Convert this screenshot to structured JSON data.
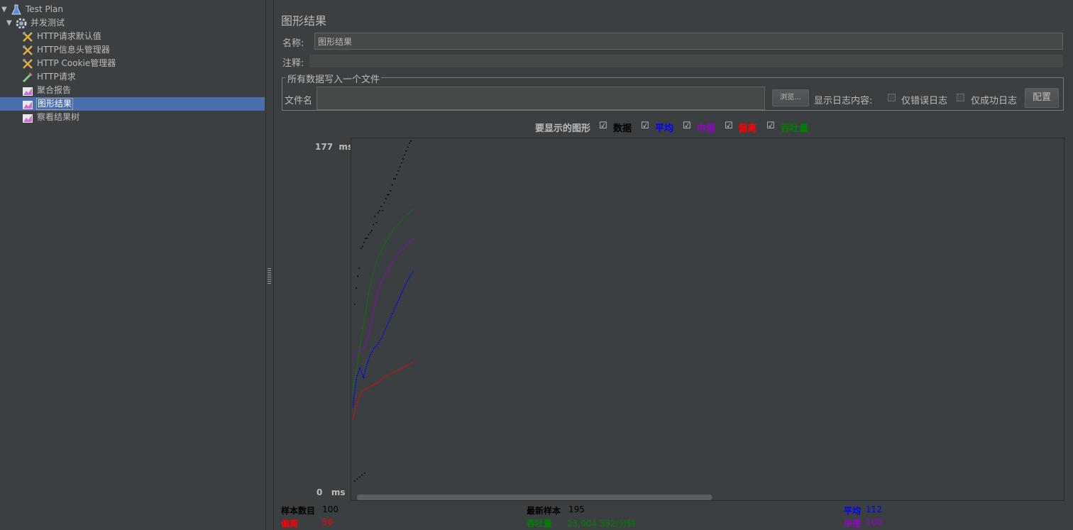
{
  "tree": {
    "items": [
      {
        "label": "Test Plan",
        "icon": "flask-icon",
        "expander": "▼"
      },
      {
        "label": "并发测试",
        "icon": "gear-icon",
        "expander": "▼"
      },
      {
        "label": "HTTP请求默认值",
        "icon": "wrench-icon"
      },
      {
        "label": "HTTP信息头管理器",
        "icon": "wrench-icon"
      },
      {
        "label": "HTTP Cookie管理器",
        "icon": "wrench-icon"
      },
      {
        "label": "HTTP请求",
        "icon": "pipette-icon"
      },
      {
        "label": "聚合报告",
        "icon": "chart-icon"
      },
      {
        "label": "图形结果",
        "icon": "chart-icon",
        "selected": true
      },
      {
        "label": "察看结果树",
        "icon": "chart-icon"
      }
    ]
  },
  "panel": {
    "title": "图形结果",
    "name_label": "名称:",
    "name_value": "图形结果",
    "comment_label": "注释:",
    "comment_value": "",
    "fieldset_legend": "所有数据写入一个文件",
    "filename_label": "文件名",
    "filename_value": "",
    "browse_label": "浏览...",
    "log_content_label": "显示日志内容:",
    "errors_only_label": "仅错误日志",
    "success_only_label": "仅成功日志",
    "configure_label": "配置"
  },
  "graph_options": {
    "label": "要显示的图形",
    "items": [
      {
        "label": "数据",
        "color": "#000000",
        "checked": true
      },
      {
        "label": "平均",
        "color": "#0000ff",
        "checked": true
      },
      {
        "label": "中值",
        "color": "#9900cc",
        "checked": true
      },
      {
        "label": "偏离",
        "color": "#ff0000",
        "checked": true
      },
      {
        "label": "吞吐量",
        "color": "#008000",
        "checked": true
      }
    ]
  },
  "chart_data": {
    "type": "line",
    "y_max_label": "177",
    "y_min_label": "0",
    "y_unit": "ms",
    "ylim": [
      0,
      177
    ],
    "x": "sample index 1–100",
    "series": [
      {
        "name": "数据",
        "color": "#000000",
        "style": "dots",
        "values": [
          95,
          103,
          109,
          113,
          123,
          124,
          126,
          128,
          128,
          130,
          131,
          132,
          135,
          139,
          136,
          141,
          142,
          144,
          142,
          146,
          148,
          150,
          150,
          152,
          155,
          158,
          158,
          160,
          162,
          164,
          166,
          168,
          170,
          172,
          174,
          176,
          177
        ]
      },
      {
        "name": "平均",
        "color": "#0000ff",
        "values": [
          43,
          58,
          63,
          58,
          65,
          70,
          73,
          75,
          78,
          82,
          86,
          90,
          94,
          98,
          102,
          106,
          109,
          112
        ]
      },
      {
        "name": "中值",
        "color": "#9900cc",
        "values": [
          68,
          72,
          72,
          78,
          90,
          102,
          108,
          112,
          117,
          121,
          123,
          126,
          128
        ]
      },
      {
        "name": "偏离",
        "color": "#ff0000",
        "values": [
          37,
          44,
          50,
          52,
          53,
          54,
          55,
          56,
          58,
          59,
          60,
          61,
          62,
          63,
          64,
          65,
          66
        ]
      },
      {
        "name": "吞吐量",
        "color": "#008000",
        "values": [
          52,
          65,
          80,
          95,
          108,
          116,
          122,
          126,
          130,
          134,
          136,
          139,
          141,
          143
        ]
      }
    ],
    "low_dots_values": [
      6,
      7,
      8,
      9,
      10
    ]
  },
  "stats": {
    "sample_count_label": "样本数目",
    "sample_count_value": "100",
    "latest_sample_label": "最新样本",
    "latest_sample_value": "195",
    "average_label": "平均",
    "average_value": "112",
    "deviation_label": "偏离",
    "deviation_value": "56",
    "throughput_label": "吞吐量",
    "throughput_value": "23,904.382/分钟",
    "median_label": "中值",
    "median_value": "100"
  }
}
